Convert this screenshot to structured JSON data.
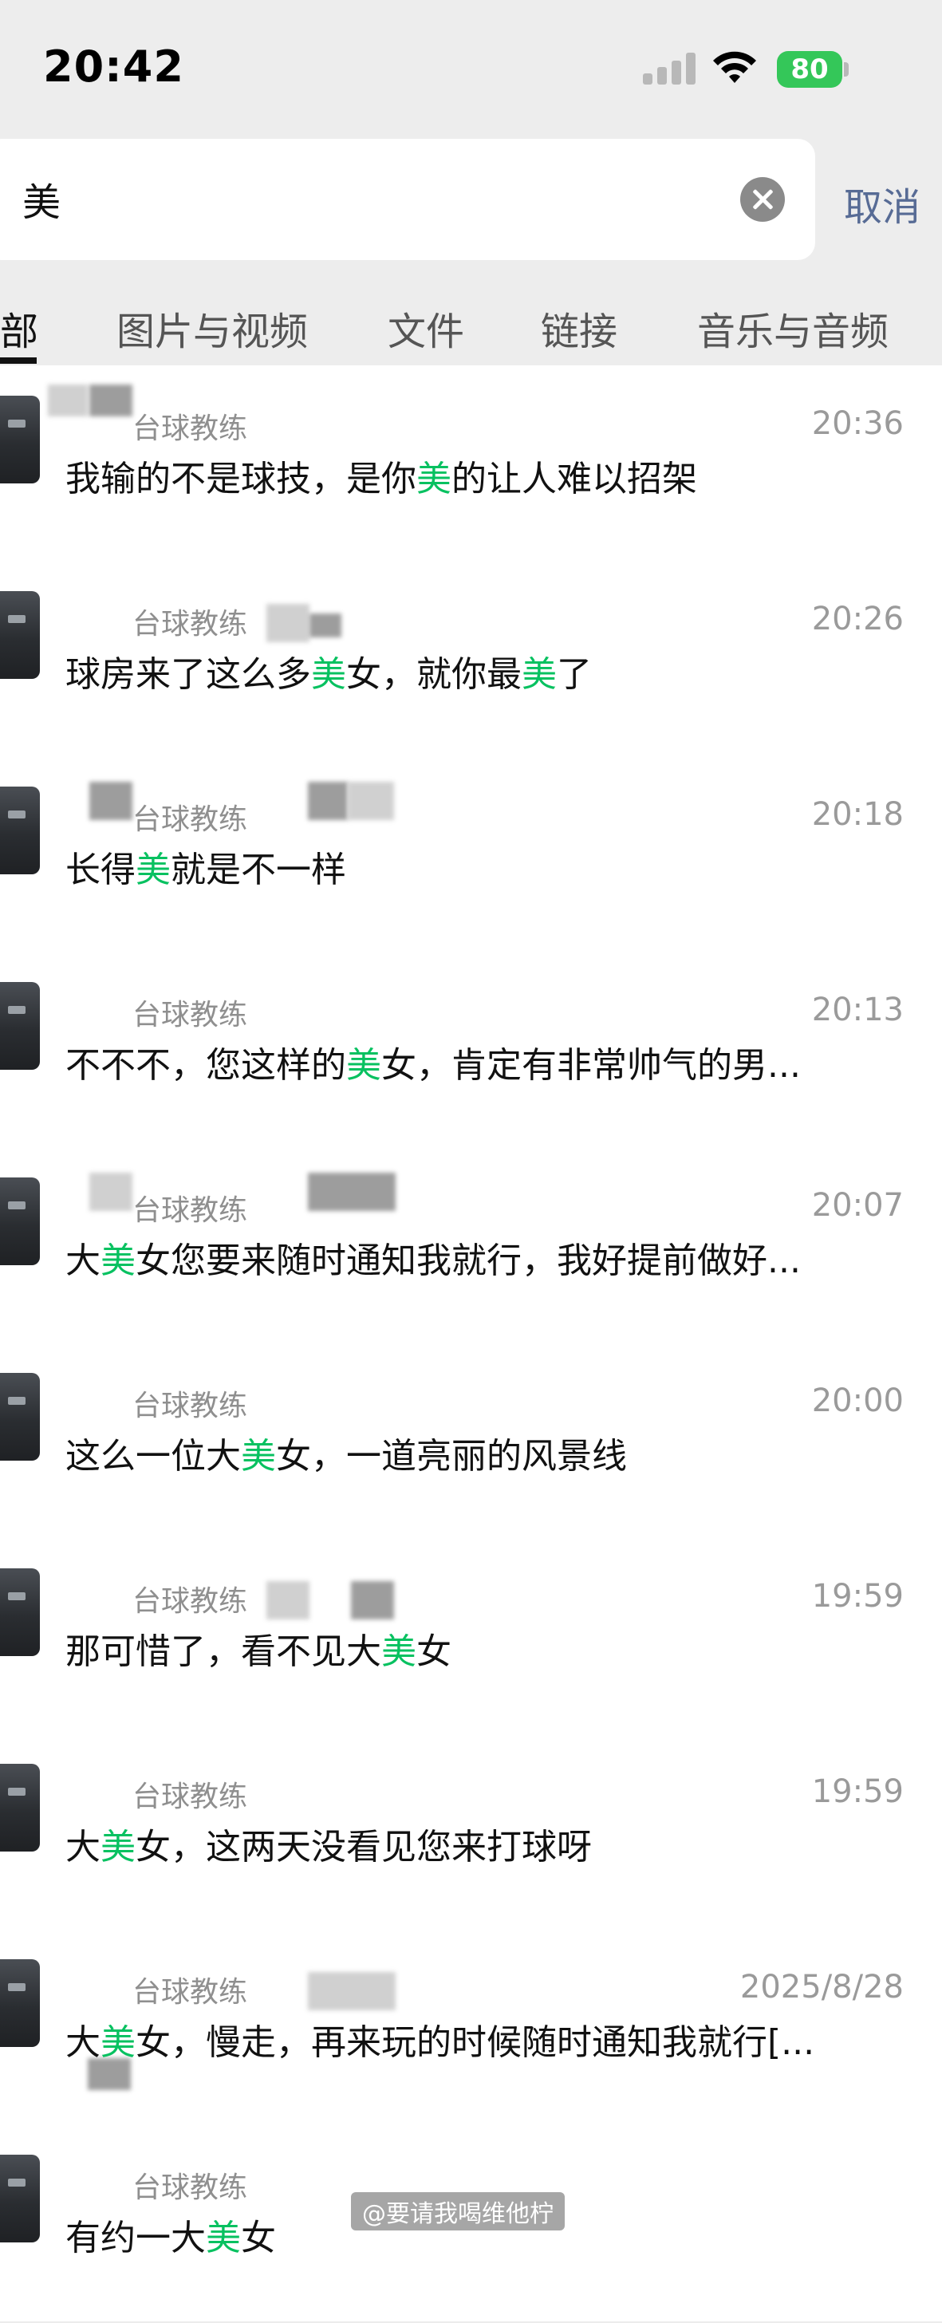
{
  "status_bar": {
    "time": "20:42",
    "battery": "80"
  },
  "search": {
    "query": "美",
    "cancel": "取消"
  },
  "tabs": [
    "部",
    "图片与视频",
    "文件",
    "链接",
    "音乐与音频"
  ],
  "contact_name": "台球教练",
  "results": [
    {
      "time": "20:36",
      "parts": [
        {
          "t": "我输的不是球技，是你"
        },
        {
          "t": "美",
          "hl": true
        },
        {
          "t": "的让人难以招架"
        }
      ]
    },
    {
      "time": "20:26",
      "parts": [
        {
          "t": "球房来了这么多"
        },
        {
          "t": "美",
          "hl": true
        },
        {
          "t": "女，就你最"
        },
        {
          "t": "美",
          "hl": true
        },
        {
          "t": "了"
        }
      ]
    },
    {
      "time": "20:18",
      "parts": [
        {
          "t": "长得"
        },
        {
          "t": "美",
          "hl": true
        },
        {
          "t": "就是不一样"
        }
      ]
    },
    {
      "time": "20:13",
      "parts": [
        {
          "t": "不不不，您这样的"
        },
        {
          "t": "美",
          "hl": true
        },
        {
          "t": "女，肯定有非常帅气的男..."
        }
      ]
    },
    {
      "time": "20:07",
      "parts": [
        {
          "t": "大"
        },
        {
          "t": "美",
          "hl": true
        },
        {
          "t": "女您要来随时通知我就行，我好提前做好..."
        }
      ]
    },
    {
      "time": "20:00",
      "parts": [
        {
          "t": "这么一位大"
        },
        {
          "t": "美",
          "hl": true
        },
        {
          "t": "女，一道亮丽的风景线"
        }
      ]
    },
    {
      "time": "19:59",
      "parts": [
        {
          "t": "那可惜了，看不见大"
        },
        {
          "t": "美",
          "hl": true
        },
        {
          "t": "女"
        }
      ]
    },
    {
      "time": "19:59",
      "parts": [
        {
          "t": "大"
        },
        {
          "t": "美",
          "hl": true
        },
        {
          "t": "女，这两天没看见您来打球呀"
        }
      ]
    },
    {
      "time": "2025/8/28",
      "parts": [
        {
          "t": "大"
        },
        {
          "t": "美",
          "hl": true
        },
        {
          "t": "女，慢走，再来玩的时候随时通知我就行[..."
        }
      ]
    },
    {
      "time": "",
      "parts": [
        {
          "t": "有"
        },
        {
          "t": "约"
        },
        {
          "t": "一大"
        },
        {
          "t": "美",
          "hl": true
        },
        {
          "t": "女"
        }
      ]
    }
  ],
  "watermark": "@要请我喝维他柠",
  "colors": {
    "highlight": "#07c160",
    "link": "#576b95",
    "header_bg": "#ededed"
  }
}
